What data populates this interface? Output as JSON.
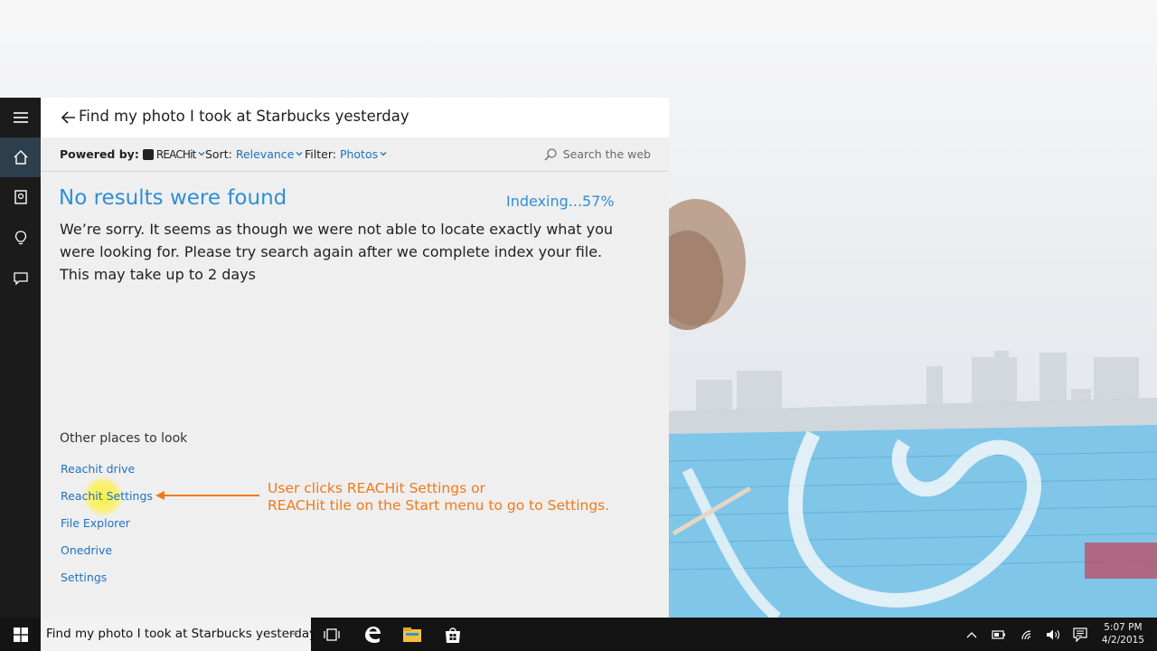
{
  "window": {
    "query_title": "Find my photo I took at Starbucks yesterday"
  },
  "rail": {
    "items": [
      "hamburger-menu-icon",
      "home-icon",
      "notebook-icon",
      "lightbulb-icon",
      "feedback-icon"
    ]
  },
  "toolbar": {
    "powered_label": "Powered by:",
    "brand": "REACHit",
    "sort_label": "Sort:",
    "sort_value": "Relevance",
    "filter_label": "Filter:",
    "filter_value": "Photos",
    "search_web_placeholder": "Search the web"
  },
  "results": {
    "heading": "No results were found",
    "indexing_status": "Indexing...57%",
    "message": "We’re sorry. It seems as though we were not able to locate exactly what you were looking for. Please try search again after we complete index your file. This may take up to 2 days"
  },
  "other_places": {
    "heading": "Other places to look",
    "links": [
      "Reachit drive",
      "Reachit Settings",
      "File Explorer",
      "Onedrive",
      "Settings"
    ]
  },
  "annotation": {
    "line1": "User clicks REACHit Settings or",
    "line2": "REACHit tile on the Start menu to go to Settings."
  },
  "taskbar": {
    "search_text": "Find my photo I took at Starbucks yesterday",
    "search_arrow": "→",
    "time": "5:07 PM",
    "date": "4/2/2015"
  },
  "colors": {
    "accent": "#2f8fd6",
    "link": "#1e72c2",
    "annotation": "#ef7a1a",
    "rail": "#1b1b1b",
    "taskbar": "#141414"
  }
}
